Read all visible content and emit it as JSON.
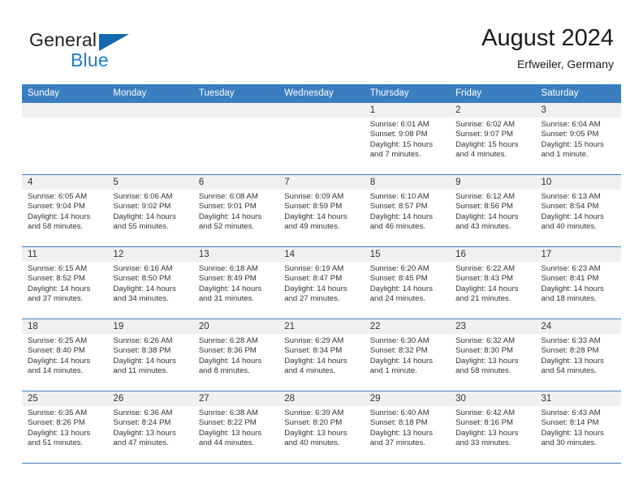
{
  "brand": {
    "name_part1": "General",
    "name_part2": "Blue",
    "triangle_color": "#1468b0",
    "blue_color": "#1b7ec9"
  },
  "header": {
    "title": "August 2024",
    "subtitle": "Erfweiler, Germany",
    "accent_color": "#3a7ec0"
  },
  "weekday_headers": [
    "Sunday",
    "Monday",
    "Tuesday",
    "Wednesday",
    "Thursday",
    "Friday",
    "Saturday"
  ],
  "labels": {
    "sunrise": "Sunrise:",
    "sunset": "Sunset:",
    "daylight": "Daylight:"
  },
  "weeks": [
    [
      {
        "day": "",
        "empty": true
      },
      {
        "day": "",
        "empty": true
      },
      {
        "day": "",
        "empty": true
      },
      {
        "day": "",
        "empty": true
      },
      {
        "day": "1",
        "sunrise": "Sunrise: 6:01 AM",
        "sunset": "Sunset: 9:08 PM",
        "daylight_line1": "Daylight: 15 hours",
        "daylight_line2": "and 7 minutes."
      },
      {
        "day": "2",
        "sunrise": "Sunrise: 6:02 AM",
        "sunset": "Sunset: 9:07 PM",
        "daylight_line1": "Daylight: 15 hours",
        "daylight_line2": "and 4 minutes."
      },
      {
        "day": "3",
        "sunrise": "Sunrise: 6:04 AM",
        "sunset": "Sunset: 9:05 PM",
        "daylight_line1": "Daylight: 15 hours",
        "daylight_line2": "and 1 minute."
      }
    ],
    [
      {
        "day": "4",
        "sunrise": "Sunrise: 6:05 AM",
        "sunset": "Sunset: 9:04 PM",
        "daylight_line1": "Daylight: 14 hours",
        "daylight_line2": "and 58 minutes."
      },
      {
        "day": "5",
        "sunrise": "Sunrise: 6:06 AM",
        "sunset": "Sunset: 9:02 PM",
        "daylight_line1": "Daylight: 14 hours",
        "daylight_line2": "and 55 minutes."
      },
      {
        "day": "6",
        "sunrise": "Sunrise: 6:08 AM",
        "sunset": "Sunset: 9:01 PM",
        "daylight_line1": "Daylight: 14 hours",
        "daylight_line2": "and 52 minutes."
      },
      {
        "day": "7",
        "sunrise": "Sunrise: 6:09 AM",
        "sunset": "Sunset: 8:59 PM",
        "daylight_line1": "Daylight: 14 hours",
        "daylight_line2": "and 49 minutes."
      },
      {
        "day": "8",
        "sunrise": "Sunrise: 6:10 AM",
        "sunset": "Sunset: 8:57 PM",
        "daylight_line1": "Daylight: 14 hours",
        "daylight_line2": "and 46 minutes."
      },
      {
        "day": "9",
        "sunrise": "Sunrise: 6:12 AM",
        "sunset": "Sunset: 8:56 PM",
        "daylight_line1": "Daylight: 14 hours",
        "daylight_line2": "and 43 minutes."
      },
      {
        "day": "10",
        "sunrise": "Sunrise: 6:13 AM",
        "sunset": "Sunset: 8:54 PM",
        "daylight_line1": "Daylight: 14 hours",
        "daylight_line2": "and 40 minutes."
      }
    ],
    [
      {
        "day": "11",
        "sunrise": "Sunrise: 6:15 AM",
        "sunset": "Sunset: 8:52 PM",
        "daylight_line1": "Daylight: 14 hours",
        "daylight_line2": "and 37 minutes."
      },
      {
        "day": "12",
        "sunrise": "Sunrise: 6:16 AM",
        "sunset": "Sunset: 8:50 PM",
        "daylight_line1": "Daylight: 14 hours",
        "daylight_line2": "and 34 minutes."
      },
      {
        "day": "13",
        "sunrise": "Sunrise: 6:18 AM",
        "sunset": "Sunset: 8:49 PM",
        "daylight_line1": "Daylight: 14 hours",
        "daylight_line2": "and 31 minutes."
      },
      {
        "day": "14",
        "sunrise": "Sunrise: 6:19 AM",
        "sunset": "Sunset: 8:47 PM",
        "daylight_line1": "Daylight: 14 hours",
        "daylight_line2": "and 27 minutes."
      },
      {
        "day": "15",
        "sunrise": "Sunrise: 6:20 AM",
        "sunset": "Sunset: 8:45 PM",
        "daylight_line1": "Daylight: 14 hours",
        "daylight_line2": "and 24 minutes."
      },
      {
        "day": "16",
        "sunrise": "Sunrise: 6:22 AM",
        "sunset": "Sunset: 8:43 PM",
        "daylight_line1": "Daylight: 14 hours",
        "daylight_line2": "and 21 minutes."
      },
      {
        "day": "17",
        "sunrise": "Sunrise: 6:23 AM",
        "sunset": "Sunset: 8:41 PM",
        "daylight_line1": "Daylight: 14 hours",
        "daylight_line2": "and 18 minutes."
      }
    ],
    [
      {
        "day": "18",
        "sunrise": "Sunrise: 6:25 AM",
        "sunset": "Sunset: 8:40 PM",
        "daylight_line1": "Daylight: 14 hours",
        "daylight_line2": "and 14 minutes."
      },
      {
        "day": "19",
        "sunrise": "Sunrise: 6:26 AM",
        "sunset": "Sunset: 8:38 PM",
        "daylight_line1": "Daylight: 14 hours",
        "daylight_line2": "and 11 minutes."
      },
      {
        "day": "20",
        "sunrise": "Sunrise: 6:28 AM",
        "sunset": "Sunset: 8:36 PM",
        "daylight_line1": "Daylight: 14 hours",
        "daylight_line2": "and 8 minutes."
      },
      {
        "day": "21",
        "sunrise": "Sunrise: 6:29 AM",
        "sunset": "Sunset: 8:34 PM",
        "daylight_line1": "Daylight: 14 hours",
        "daylight_line2": "and 4 minutes."
      },
      {
        "day": "22",
        "sunrise": "Sunrise: 6:30 AM",
        "sunset": "Sunset: 8:32 PM",
        "daylight_line1": "Daylight: 14 hours",
        "daylight_line2": "and 1 minute."
      },
      {
        "day": "23",
        "sunrise": "Sunrise: 6:32 AM",
        "sunset": "Sunset: 8:30 PM",
        "daylight_line1": "Daylight: 13 hours",
        "daylight_line2": "and 58 minutes."
      },
      {
        "day": "24",
        "sunrise": "Sunrise: 6:33 AM",
        "sunset": "Sunset: 8:28 PM",
        "daylight_line1": "Daylight: 13 hours",
        "daylight_line2": "and 54 minutes."
      }
    ],
    [
      {
        "day": "25",
        "sunrise": "Sunrise: 6:35 AM",
        "sunset": "Sunset: 8:26 PM",
        "daylight_line1": "Daylight: 13 hours",
        "daylight_line2": "and 51 minutes."
      },
      {
        "day": "26",
        "sunrise": "Sunrise: 6:36 AM",
        "sunset": "Sunset: 8:24 PM",
        "daylight_line1": "Daylight: 13 hours",
        "daylight_line2": "and 47 minutes."
      },
      {
        "day": "27",
        "sunrise": "Sunrise: 6:38 AM",
        "sunset": "Sunset: 8:22 PM",
        "daylight_line1": "Daylight: 13 hours",
        "daylight_line2": "and 44 minutes."
      },
      {
        "day": "28",
        "sunrise": "Sunrise: 6:39 AM",
        "sunset": "Sunset: 8:20 PM",
        "daylight_line1": "Daylight: 13 hours",
        "daylight_line2": "and 40 minutes."
      },
      {
        "day": "29",
        "sunrise": "Sunrise: 6:40 AM",
        "sunset": "Sunset: 8:18 PM",
        "daylight_line1": "Daylight: 13 hours",
        "daylight_line2": "and 37 minutes."
      },
      {
        "day": "30",
        "sunrise": "Sunrise: 6:42 AM",
        "sunset": "Sunset: 8:16 PM",
        "daylight_line1": "Daylight: 13 hours",
        "daylight_line2": "and 33 minutes."
      },
      {
        "day": "31",
        "sunrise": "Sunrise: 6:43 AM",
        "sunset": "Sunset: 8:14 PM",
        "daylight_line1": "Daylight: 13 hours",
        "daylight_line2": "and 30 minutes."
      }
    ]
  ]
}
